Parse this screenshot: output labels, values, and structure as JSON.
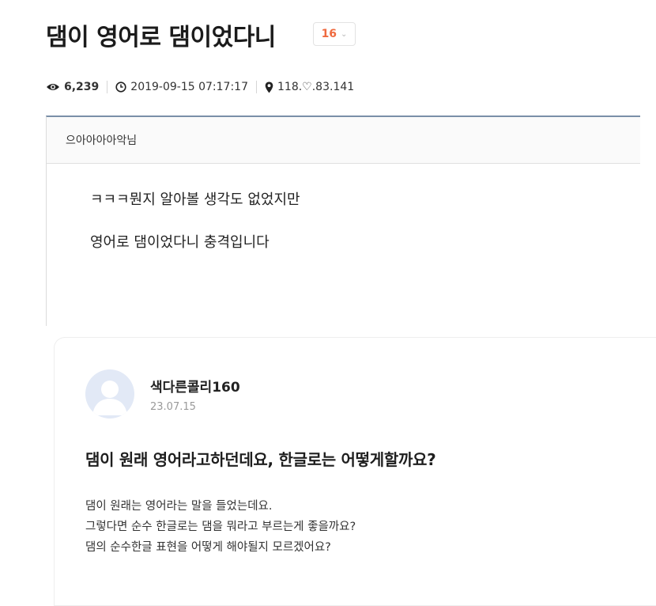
{
  "post": {
    "title": "댐이 영어로 댐이었다니",
    "vote_count": "16",
    "views": "6,239",
    "datetime": "2019-09-15 07:17:17",
    "ip": "118.♡.83.141",
    "author": "으아아아아악님",
    "body_lines": [
      "ㅋㅋㅋ뭔지 알아볼 생각도 없었지만",
      "영어로 댐이었다니 충격입니다"
    ]
  },
  "question": {
    "username": "색다른콜리160",
    "date": "23.07.15",
    "title": "댐이 원래 영어라고하던데요, 한글로는 어떻게할까요?",
    "body_lines": [
      "댐이 원래는 영어라는 말을 들었는데요.",
      "그렇다면 순수 한글로는 댐을 뭐라고 부르는게 좋을까요?",
      "댐의 순수한글 표현을 어떻게 해야될지 모르겠어요?"
    ]
  },
  "icons": {
    "views": "eye-icon",
    "datetime": "clock-icon",
    "ip": "location-pin-icon",
    "vote_toggle": "chevron-down-icon",
    "avatar": "user-avatar-icon"
  },
  "colors": {
    "vote_accent": "#ef6a3f",
    "post_border_accent": "#7a8fa8",
    "avatar_bg": "#e2e9f6"
  }
}
